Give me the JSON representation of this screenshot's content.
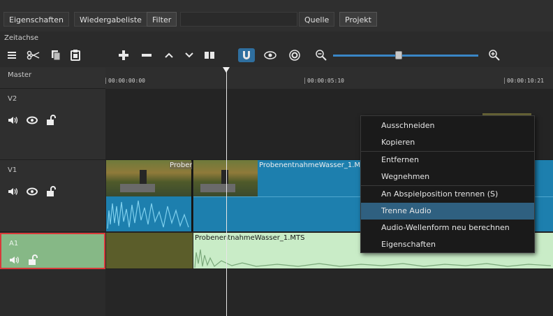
{
  "tabs": [
    {
      "label": "Eigenschaften"
    },
    {
      "label": "Wiedergabeliste"
    },
    {
      "label": "Filter"
    },
    {
      "label": "Quelle"
    },
    {
      "label": "Projekt"
    }
  ],
  "panel": {
    "title": "Zeitachse"
  },
  "toolbar": {
    "icons": [
      "menu-icon",
      "scissors-icon",
      "copy-icon",
      "paste-icon",
      "plus-icon",
      "minus-icon",
      "lift-icon",
      "overwrite-icon",
      "split-icon",
      "snap-icon",
      "scrub-icon",
      "ripple-icon",
      "zoom-out-icon",
      "zoom-in-icon"
    ],
    "snap_active_color": "#2f6f9f",
    "zoom_level": 0.42
  },
  "tracks": {
    "master": "Master",
    "v2": "V2",
    "v1": "V1",
    "a1": "A1"
  },
  "ruler": {
    "t0": "00:00:00:00",
    "t1": "00:00:05:10",
    "t2": "00:00:10:21"
  },
  "clips": {
    "v1_clip_a": "Prober",
    "v1_clip_b": "ProbenentnahmeWasser_1.M",
    "a1_clip": "ProbenentnahmeWasser_1.MTS"
  },
  "context_menu": {
    "items": [
      "Ausschneiden",
      "Kopieren",
      "Entfernen",
      "Wegnehmen",
      "An Abspielposition trennen (S)",
      "Trenne Audio",
      "Audio-Wellenform neu berechnen",
      "Eigenschaften"
    ],
    "highlighted": "Trenne Audio"
  },
  "colors": {
    "video_clip": "#1d7fae",
    "audio_clip": "#c9ecc7",
    "a1_selected": "#7fb07f",
    "a1_gap": "#5b5d2a",
    "selection_border": "#d93a3a"
  }
}
